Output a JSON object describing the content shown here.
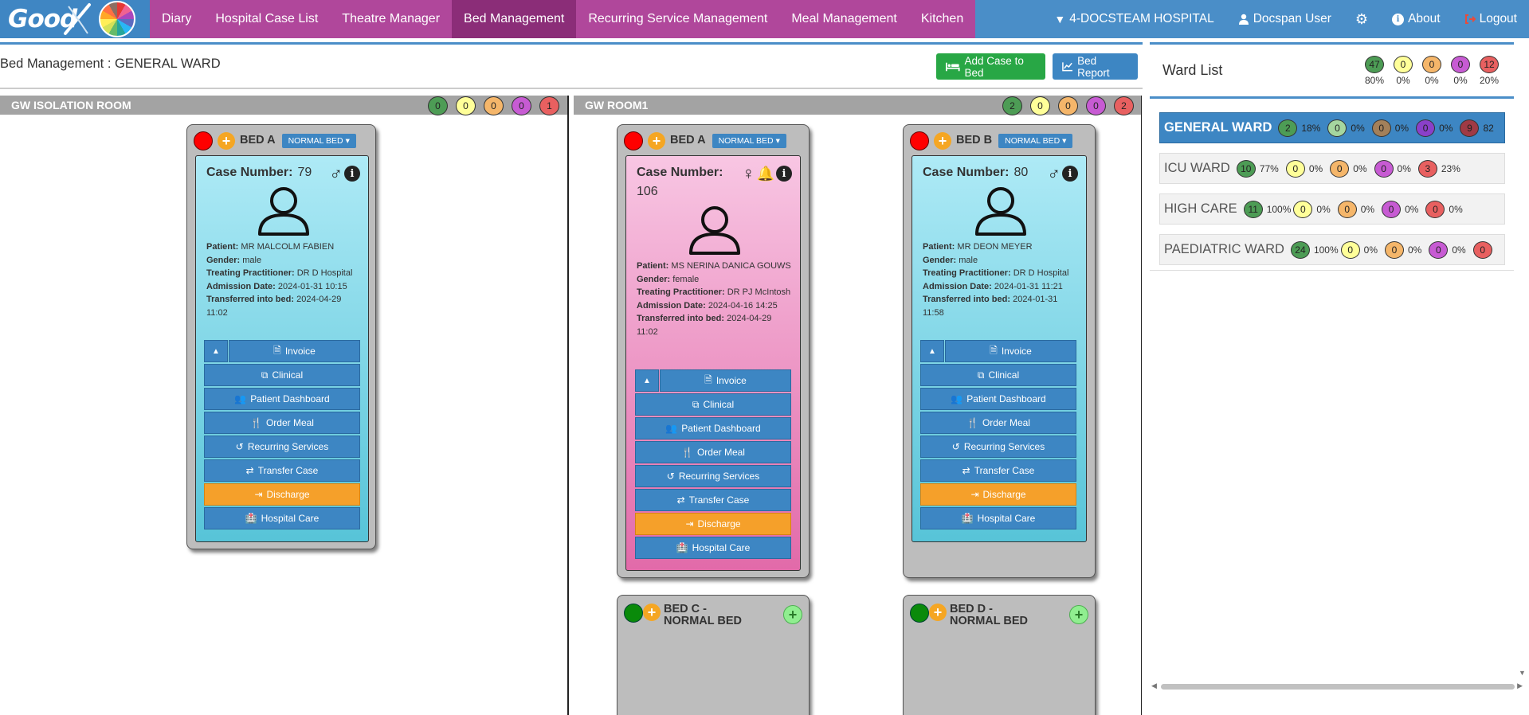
{
  "nav": {
    "logo": "Good",
    "items": [
      "Diary",
      "Hospital Case List",
      "Theatre Manager",
      "Bed Management",
      "Recurring Service Management",
      "Meal Management",
      "Kitchen"
    ],
    "active": "Bed Management",
    "hospital": "4-DOCSTEAM HOSPITAL",
    "user": "Docspan User",
    "about": "About",
    "logout": "Logout"
  },
  "page": {
    "title": "Bed Management : GENERAL WARD",
    "add_case_btn": "Add Case to Bed",
    "bed_report_btn": "Bed Report"
  },
  "rooms": [
    {
      "name": "GW ISOLATION ROOM",
      "badges": [
        "0",
        "0",
        "0",
        "0",
        "1"
      ]
    },
    {
      "name": "GW ROOM1",
      "badges": [
        "2",
        "0",
        "0",
        "0",
        "2"
      ]
    }
  ],
  "labels": {
    "case_number": "Case Number:",
    "patient": "Patient:",
    "gender": "Gender:",
    "practitioner": "Treating Practitioner:",
    "admission": "Admission Date:",
    "transferred": "Transferred into bed:",
    "bed_type": "NORMAL BED"
  },
  "actions": [
    "Invoice",
    "Clinical",
    "Patient Dashboard",
    "Order Meal",
    "Recurring Services",
    "Transfer Case",
    "Discharge",
    "Hospital Care"
  ],
  "beds": [
    {
      "name": "BED A",
      "case_number": "79",
      "patient": "MR MALCOLM FABIEN",
      "gender": "male",
      "practitioner": "DR D Hospital",
      "admission": "2024-01-31 10:15",
      "transferred": "2024-04-29 11:02"
    },
    {
      "name": "BED A",
      "case_number": "106",
      "patient": "MS NERINA DANICA GOUWS",
      "gender": "female",
      "practitioner": "DR PJ McIntosh",
      "admission": "2024-04-16 14:25",
      "transferred": "2024-04-29 11:02"
    },
    {
      "name": "BED B",
      "case_number": "80",
      "patient": "MR DEON MEYER",
      "gender": "male",
      "practitioner": "DR D Hospital",
      "admission": "2024-01-31 11:21",
      "transferred": "2024-01-31 11:58"
    },
    {
      "name": "BED C - NORMAL BED"
    },
    {
      "name": "BED D - NORMAL BED"
    }
  ],
  "ward_list": {
    "title": "Ward List",
    "totals": [
      {
        "count": "47",
        "pct": "80%"
      },
      {
        "count": "0",
        "pct": "0%"
      },
      {
        "count": "0",
        "pct": "0%"
      },
      {
        "count": "0",
        "pct": "0%"
      },
      {
        "count": "12",
        "pct": "20%"
      }
    ],
    "wards": [
      {
        "name": "GENERAL WARD",
        "counts": [
          "2",
          "0",
          "0",
          "0",
          "9"
        ],
        "pcts": [
          "18%",
          "0%",
          "0%",
          "0%",
          "82"
        ]
      },
      {
        "name": "ICU WARD",
        "counts": [
          "10",
          "0",
          "0",
          "0",
          "3"
        ],
        "pcts": [
          "77%",
          "0%",
          "0%",
          "0%",
          "23%"
        ]
      },
      {
        "name": "HIGH CARE",
        "counts": [
          "11",
          "0",
          "0",
          "0",
          "0"
        ],
        "pcts": [
          "100%",
          "0%",
          "0%",
          "0%",
          "0%"
        ]
      },
      {
        "name": "PAEDIATRIC WARD",
        "counts": [
          "24",
          "0",
          "0",
          "0",
          "0"
        ],
        "pcts": [
          "100%",
          "0%",
          "0%",
          "0%",
          ""
        ]
      }
    ]
  }
}
